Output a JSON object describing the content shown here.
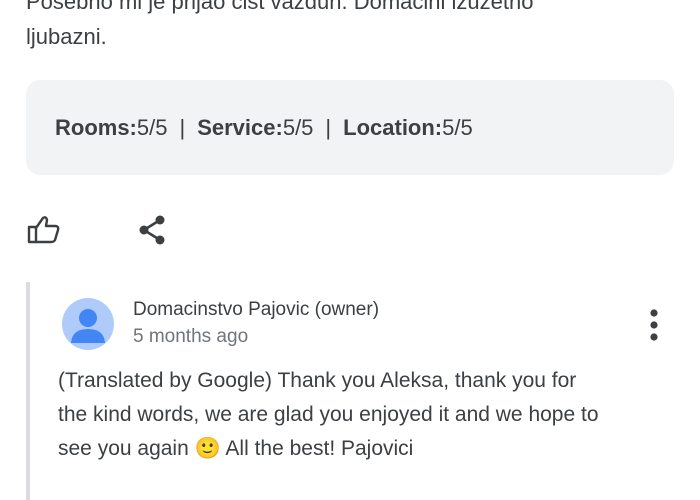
{
  "review": {
    "text_line1": "Posebno mi je prijao čist vazduh. Domaćini izuzetno",
    "text_line2": "ljubazni."
  },
  "ratings": {
    "rooms_label": "Rooms:",
    "rooms_value": " 5/5",
    "service_label": "Service:",
    "service_value": " 5/5",
    "location_label": "Location:",
    "location_value": " 5/5",
    "separator": "|"
  },
  "actions": {
    "like_icon": "thumb-up-icon",
    "share_icon": "share-icon"
  },
  "owner_reply": {
    "author": "Domacinstvo Pajovic (owner)",
    "time": "5 months ago",
    "text_line1": "(Translated by Google) Thank you Aleksa, thank you for",
    "text_line2": "the kind words, we are glad you enjoyed it and we hope to",
    "text_line3": "see you again 🙂 All the best! Pajovici",
    "avatar_icon": "person-avatar-icon",
    "more_icon": "more-vertical-icon"
  },
  "colors": {
    "text": "#3c4043",
    "muted": "#70757a",
    "rating_bg": "#f1f3f4",
    "avatar_bg": "#aecbfa",
    "avatar_fg": "#4285f4",
    "divider": "#dadce0"
  }
}
